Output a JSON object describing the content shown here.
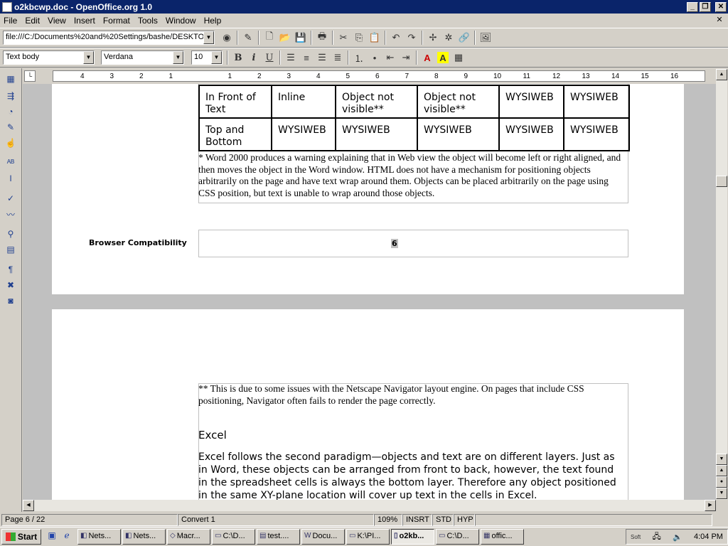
{
  "window": {
    "title": "o2kbcwp.doc - OpenOffice.org 1.0",
    "minimize": "_",
    "restore": "❐",
    "close": "✕"
  },
  "menu": [
    "File",
    "Edit",
    "View",
    "Insert",
    "Format",
    "Tools",
    "Window",
    "Help"
  ],
  "function_bar": {
    "url": "file:///C:/Documents%20and%20Settings/bashe/DESKTOP"
  },
  "object_bar": {
    "style": "Text body",
    "font": "Verdana",
    "size": "10",
    "bold": "B",
    "italic": "i",
    "underline": "U",
    "font_color": "A",
    "highlight": "A"
  },
  "ruler": {
    "ticks": [
      "4",
      "3",
      "2",
      "1",
      "1",
      "2",
      "3",
      "4",
      "5",
      "6",
      "7",
      "8",
      "9",
      "10",
      "11",
      "12",
      "13",
      "14",
      "15",
      "16"
    ]
  },
  "document": {
    "table_rows": [
      [
        "In Front of Text",
        "Inline",
        "Object not visible**",
        "Object not visible**",
        "WYSIWEB",
        "WYSIWEB"
      ],
      [
        "Top and Bottom",
        "WYSIWEB",
        "WYSIWEB",
        "WYSIWEB",
        "WYSIWEB",
        "WYSIWEB"
      ]
    ],
    "footnote1": "* Word 2000 produces a warning explaining that in Web view the object will become left or right aligned, and then moves the object in the Word window.  HTML does not have a mechanism for positioning objects arbitrarily on the page and have text wrap around them. Objects can be placed arbitrarily on the page using CSS position, but text is unable to wrap around those objects.",
    "browser_label": "Browser Compatibility",
    "browser_value": "6",
    "footnote2": "** This is due to some issues with the Netscape Navigator layout engine. On pages that include CSS positioning, Navigator often fails to render the page correctly.",
    "heading": "Excel",
    "paragraph": "Excel follows the second paradigm—objects and text are on different layers. Just as in Word, these objects can be arranged from front to back, however, the text found in the spreadsheet cells is always the bottom layer. Therefore any object positioned in the same XY-plane location will cover up text in the cells in Excel."
  },
  "status": {
    "page": "Page 6 / 22",
    "style": "Convert 1",
    "zoom": "109%",
    "insert": "INSRT",
    "selection": "STD",
    "hyphen": "HYP"
  },
  "taskbar": {
    "start": "Start",
    "tasks": [
      "Nets...",
      "Nets...",
      "Macr...",
      "C:\\D...",
      "test....",
      "Docu...",
      "K:\\PI...",
      "o2kb...",
      "C:\\D...",
      "offic..."
    ],
    "clock": "4:04 PM",
    "tray_label": "Soft"
  }
}
